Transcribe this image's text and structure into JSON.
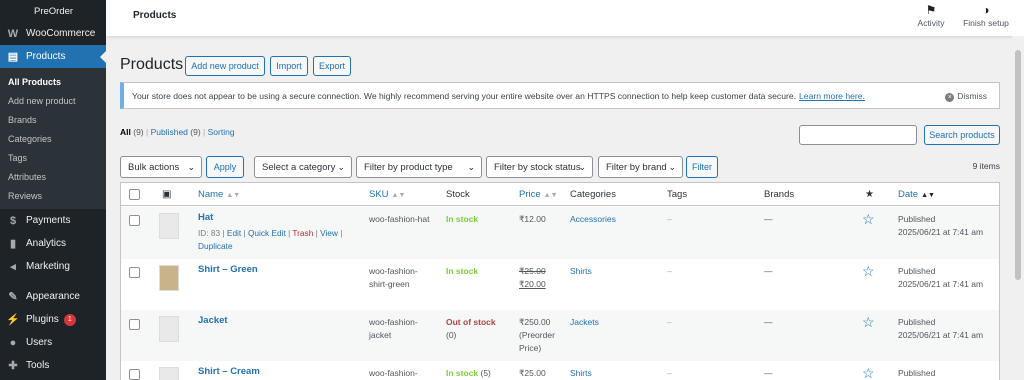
{
  "sidebar": {
    "top_label": "PreOrder",
    "woocommerce": "WooCommerce",
    "products": "Products",
    "submenu": [
      "All Products",
      "Add new product",
      "Brands",
      "Categories",
      "Tags",
      "Attributes",
      "Reviews"
    ],
    "payments": "Payments",
    "analytics": "Analytics",
    "marketing": "Marketing",
    "appearance": "Appearance",
    "plugins": "Plugins",
    "plugins_badge": "1",
    "users": "Users",
    "tools": "Tools"
  },
  "topbar": {
    "title": "Products",
    "activity": "Activity",
    "finish_setup": "Finish setup"
  },
  "page": {
    "heading": "Products",
    "add_new": "Add new product",
    "import": "Import",
    "export": "Export"
  },
  "notice": {
    "text": "Your store does not appear to be using a secure connection. We highly recommend serving your entire website over an HTTPS connection to help keep customer data secure.",
    "link": "Learn more here.",
    "dismiss": "Dismiss"
  },
  "views": {
    "all": "All",
    "all_count": "(9)",
    "published": "Published",
    "published_count": "(9)",
    "sorting": "Sorting"
  },
  "search": {
    "button": "Search products",
    "value": ""
  },
  "filters": {
    "bulk_actions": "Bulk actions",
    "apply": "Apply",
    "category": "Select a category",
    "product_type": "Filter by product type",
    "stock_status": "Filter by stock status",
    "brand": "Filter by brand",
    "filter": "Filter",
    "items_count": "9 items"
  },
  "columns": {
    "name": "Name",
    "sku": "SKU",
    "stock": "Stock",
    "price": "Price",
    "categories": "Categories",
    "tags": "Tags",
    "brands": "Brands",
    "date": "Date"
  },
  "rows": [
    {
      "name": "Hat",
      "id_label": "ID: 83",
      "edit": "Edit",
      "quick_edit": "Quick Edit",
      "trash": "Trash",
      "view": "View",
      "duplicate": "Duplicate",
      "sku": "woo-fashion-hat",
      "stock": "In stock",
      "price": "₹12.00",
      "category": "Accessories",
      "tags": "–",
      "brands": "—",
      "date_status": "Published",
      "date": "2025/06/21 at 7:41 am"
    },
    {
      "name": "Shirt – Green",
      "sku_line1": "woo-fashion-",
      "sku_line2": "shirt-green",
      "stock": "In stock",
      "price_old": "₹25.00",
      "price_new": "₹20.00",
      "category": "Shirts",
      "tags": "–",
      "brands": "—",
      "date_status": "Published",
      "date": "2025/06/21 at 7:41 am"
    },
    {
      "name": "Jacket",
      "sku_line1": "woo-fashion-",
      "sku_line2": "jacket",
      "stock": "Out of stock",
      "stock_count": "(0)",
      "price": "₹250.00",
      "price_note1": "(Preorder",
      "price_note2": "Price)",
      "category": "Jackets",
      "tags": "–",
      "brands": "—",
      "date_status": "Published",
      "date": "2025/06/21 at 7:41 am"
    },
    {
      "name": "Shirt – Cream",
      "sku_line1": "woo-fashion-",
      "stock": "In stock",
      "stock_count": "(5)",
      "price": "₹25.00",
      "category": "Shirts",
      "tags": "–",
      "brands": "—",
      "date_status": "Published"
    }
  ]
}
